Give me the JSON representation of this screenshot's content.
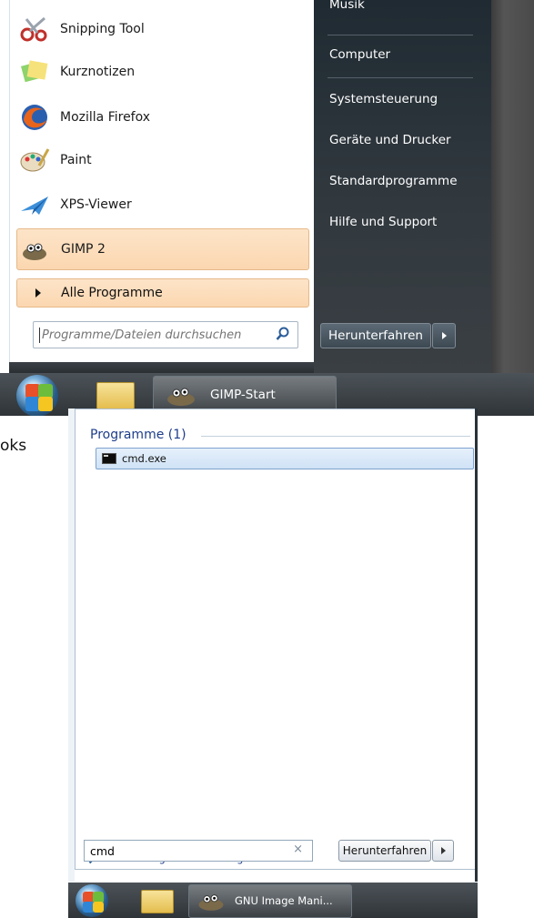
{
  "top_menu": {
    "programs": [
      {
        "label": "Snipping Tool",
        "icon": "snipping-tool-icon"
      },
      {
        "label": "Kurznotizen",
        "icon": "sticky-notes-icon"
      },
      {
        "label": "Mozilla Firefox",
        "icon": "firefox-icon"
      },
      {
        "label": "Paint",
        "icon": "paint-palette-icon"
      },
      {
        "label": "XPS-Viewer",
        "icon": "xps-viewer-icon"
      },
      {
        "label": "GIMP 2",
        "icon": "gimp-icon"
      }
    ],
    "all_programs": "Alle Programme",
    "search_placeholder": "Programme/Dateien durchsuchen",
    "right_links": [
      "Musik",
      "Computer",
      "Systemsteuerung",
      "Geräte und Drucker",
      "Standardprogramme",
      "Hilfe und Support"
    ],
    "shutdown_label": "Herunterfahren",
    "taskbar_window_label": "GIMP-Start"
  },
  "side_text": "oks",
  "search_menu": {
    "section_title": "Programme (1)",
    "result_label": "cmd.exe",
    "more_results": "Weitere Ergebnisse anzeigen",
    "query": "cmd",
    "clear_symbol": "×",
    "shutdown_label": "Herunterfahren",
    "taskbar_window_label": "GNU Image Mani..."
  },
  "colors": {
    "highlight": "#fbd7b0",
    "right_pane": "#2a3238",
    "link_blue": "#1e3d8a"
  }
}
